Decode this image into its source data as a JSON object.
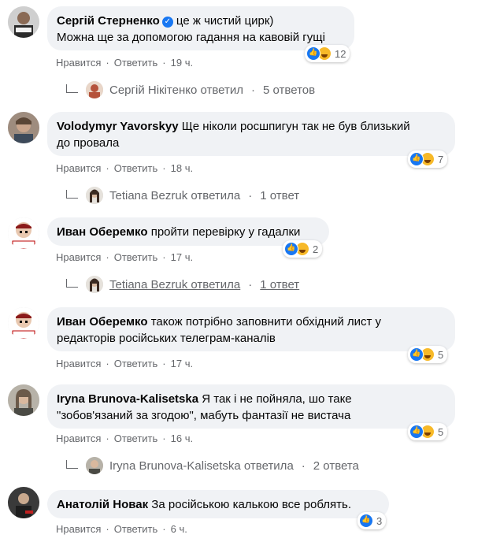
{
  "comments": [
    {
      "author": "Сергій Стерненко",
      "verified": true,
      "line1": " це ж чистий цирк)",
      "line2": "Можна ще за допомогою гадання на кавовій гущі",
      "like": "Нравится",
      "reply": "Ответить",
      "time": "19 ч.",
      "reactions": "12",
      "replies": {
        "name": "Сергій Нікітенко ответил",
        "count": "5 ответов"
      }
    },
    {
      "author": "Volodymyr Yavorskyy",
      "line1": " Ще ніколи росшпигун так не був близький",
      "line2": "до провала",
      "like": "Нравится",
      "reply": "Ответить",
      "time": "18 ч.",
      "reactions": "7",
      "replies": {
        "name": "Tetiana Bezruk ответила",
        "count": "1 ответ"
      }
    },
    {
      "author": "Иван Оберемко",
      "line1": " пройти перевірку у гадалки",
      "like": "Нравится",
      "reply": "Ответить",
      "time": "17 ч.",
      "reactions": "2",
      "replies": {
        "name": "Tetiana Bezruk ответила",
        "count": "1 ответ"
      }
    },
    {
      "author": "Иван Оберемко",
      "line1": " також потрібно заповнити обхідний лист у",
      "line2": "редакторів російських телеграм-каналів",
      "like": "Нравится",
      "reply": "Ответить",
      "time": "17 ч.",
      "reactions": "5"
    },
    {
      "author": "Iryna Brunova-Kalisetska",
      "line1": " Я так і не пойняла, шо таке",
      "line2": "\"зобов'язаний за згодою\", мабуть фантазії не вистача",
      "like": "Нравится",
      "reply": "Ответить",
      "time": "16 ч.",
      "reactions": "5",
      "replies": {
        "name": "Iryna Brunova-Kalisetska ответила",
        "count": "2 ответа"
      }
    },
    {
      "author": "Анатолій Новак",
      "line1": " За російською калькою все роблять.",
      "like": "Нравится",
      "reply": "Ответить",
      "time": "6 ч.",
      "reactions": "3"
    }
  ],
  "colors": {
    "bubble": "#f0f2f5",
    "meta": "#65676b",
    "like": "#1877f2",
    "haha": "#f7b928"
  },
  "separator": "·"
}
